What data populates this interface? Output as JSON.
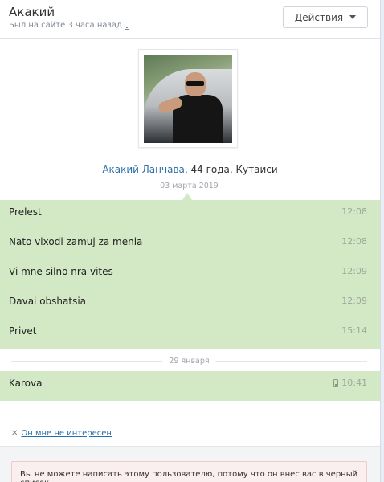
{
  "header": {
    "name": "Акакий",
    "status": "Был на сайте 3 часа назад",
    "status_icon": "mobile-phone-icon",
    "actions_label": "Действия"
  },
  "profile": {
    "name_link": "Акакий Ланчава",
    "details": ", 44 года, Кутаиси"
  },
  "date_separators": [
    "03 марта 2019",
    "29 января"
  ],
  "messages_group1": [
    {
      "text": "Prelest",
      "time": "12:08"
    },
    {
      "text": "Nato vixodi zamuj za menia",
      "time": "12:08"
    },
    {
      "text": "Vi mne silno nra vites",
      "time": "12:09"
    },
    {
      "text": "Davai obshatsia",
      "time": "12:09"
    },
    {
      "text": "Privet",
      "time": "15:14"
    }
  ],
  "messages_group2": [
    {
      "text": "Karova",
      "time": "10:41",
      "icon": "mobile-phone-icon"
    }
  ],
  "not_interested": {
    "icon": "close-icon",
    "label": "Он мне не интересен"
  },
  "warning": "Вы не можете написать этому пользователю, потому что он внес вас в черный список.",
  "colors": {
    "message_bg": "#d3e8c4",
    "link": "#2a6ea8",
    "warning_bg": "#fbeeee"
  }
}
